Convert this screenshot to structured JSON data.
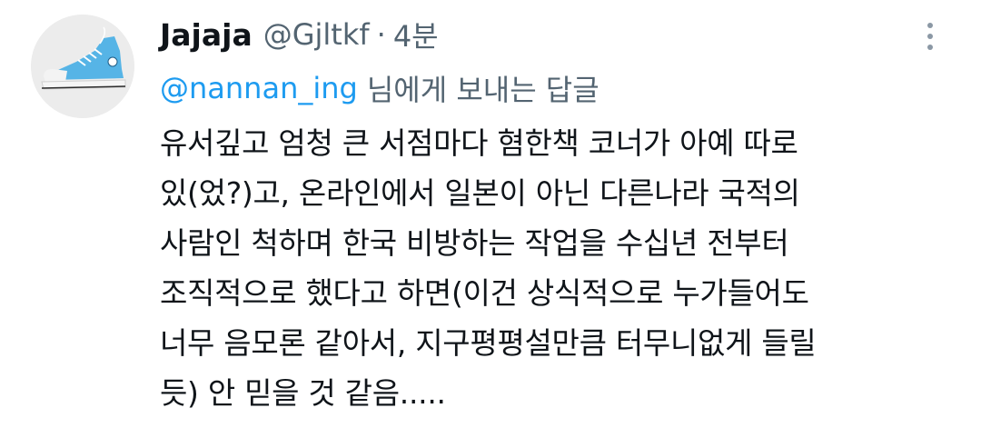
{
  "tweet": {
    "display_name": "Jajaja",
    "handle": "@Gjltkf",
    "separator": "·",
    "time": "4분",
    "avatar_icon": "sneaker-avatar-icon",
    "more_icon": "vertical-ellipsis-icon",
    "reply": {
      "mention": "@nannan_ing",
      "suffix": "님에게 보내는 답글"
    },
    "lines": [
      "유서깊고 엄청 큰 서점마다 혐한책 코너가 아예 따로",
      "있(었?)고, 온라인에서 일본이 아닌 다른나라 국적의",
      "사람인 척하며 한국 비방하는 작업을 수십년 전부터",
      "조직적으로 했다고 하면(이건 상식적으로 누가들어도",
      "너무 음모론 같아서, 지구평평설만큼 터무니없게 들릴",
      "듯) 안 믿을 것 같음....."
    ]
  },
  "colors": {
    "text": "#0f1419",
    "secondary": "#536471",
    "link": "#1d9bf0",
    "avatar_bg": "#ececec",
    "sneaker": "#56b4e6"
  }
}
